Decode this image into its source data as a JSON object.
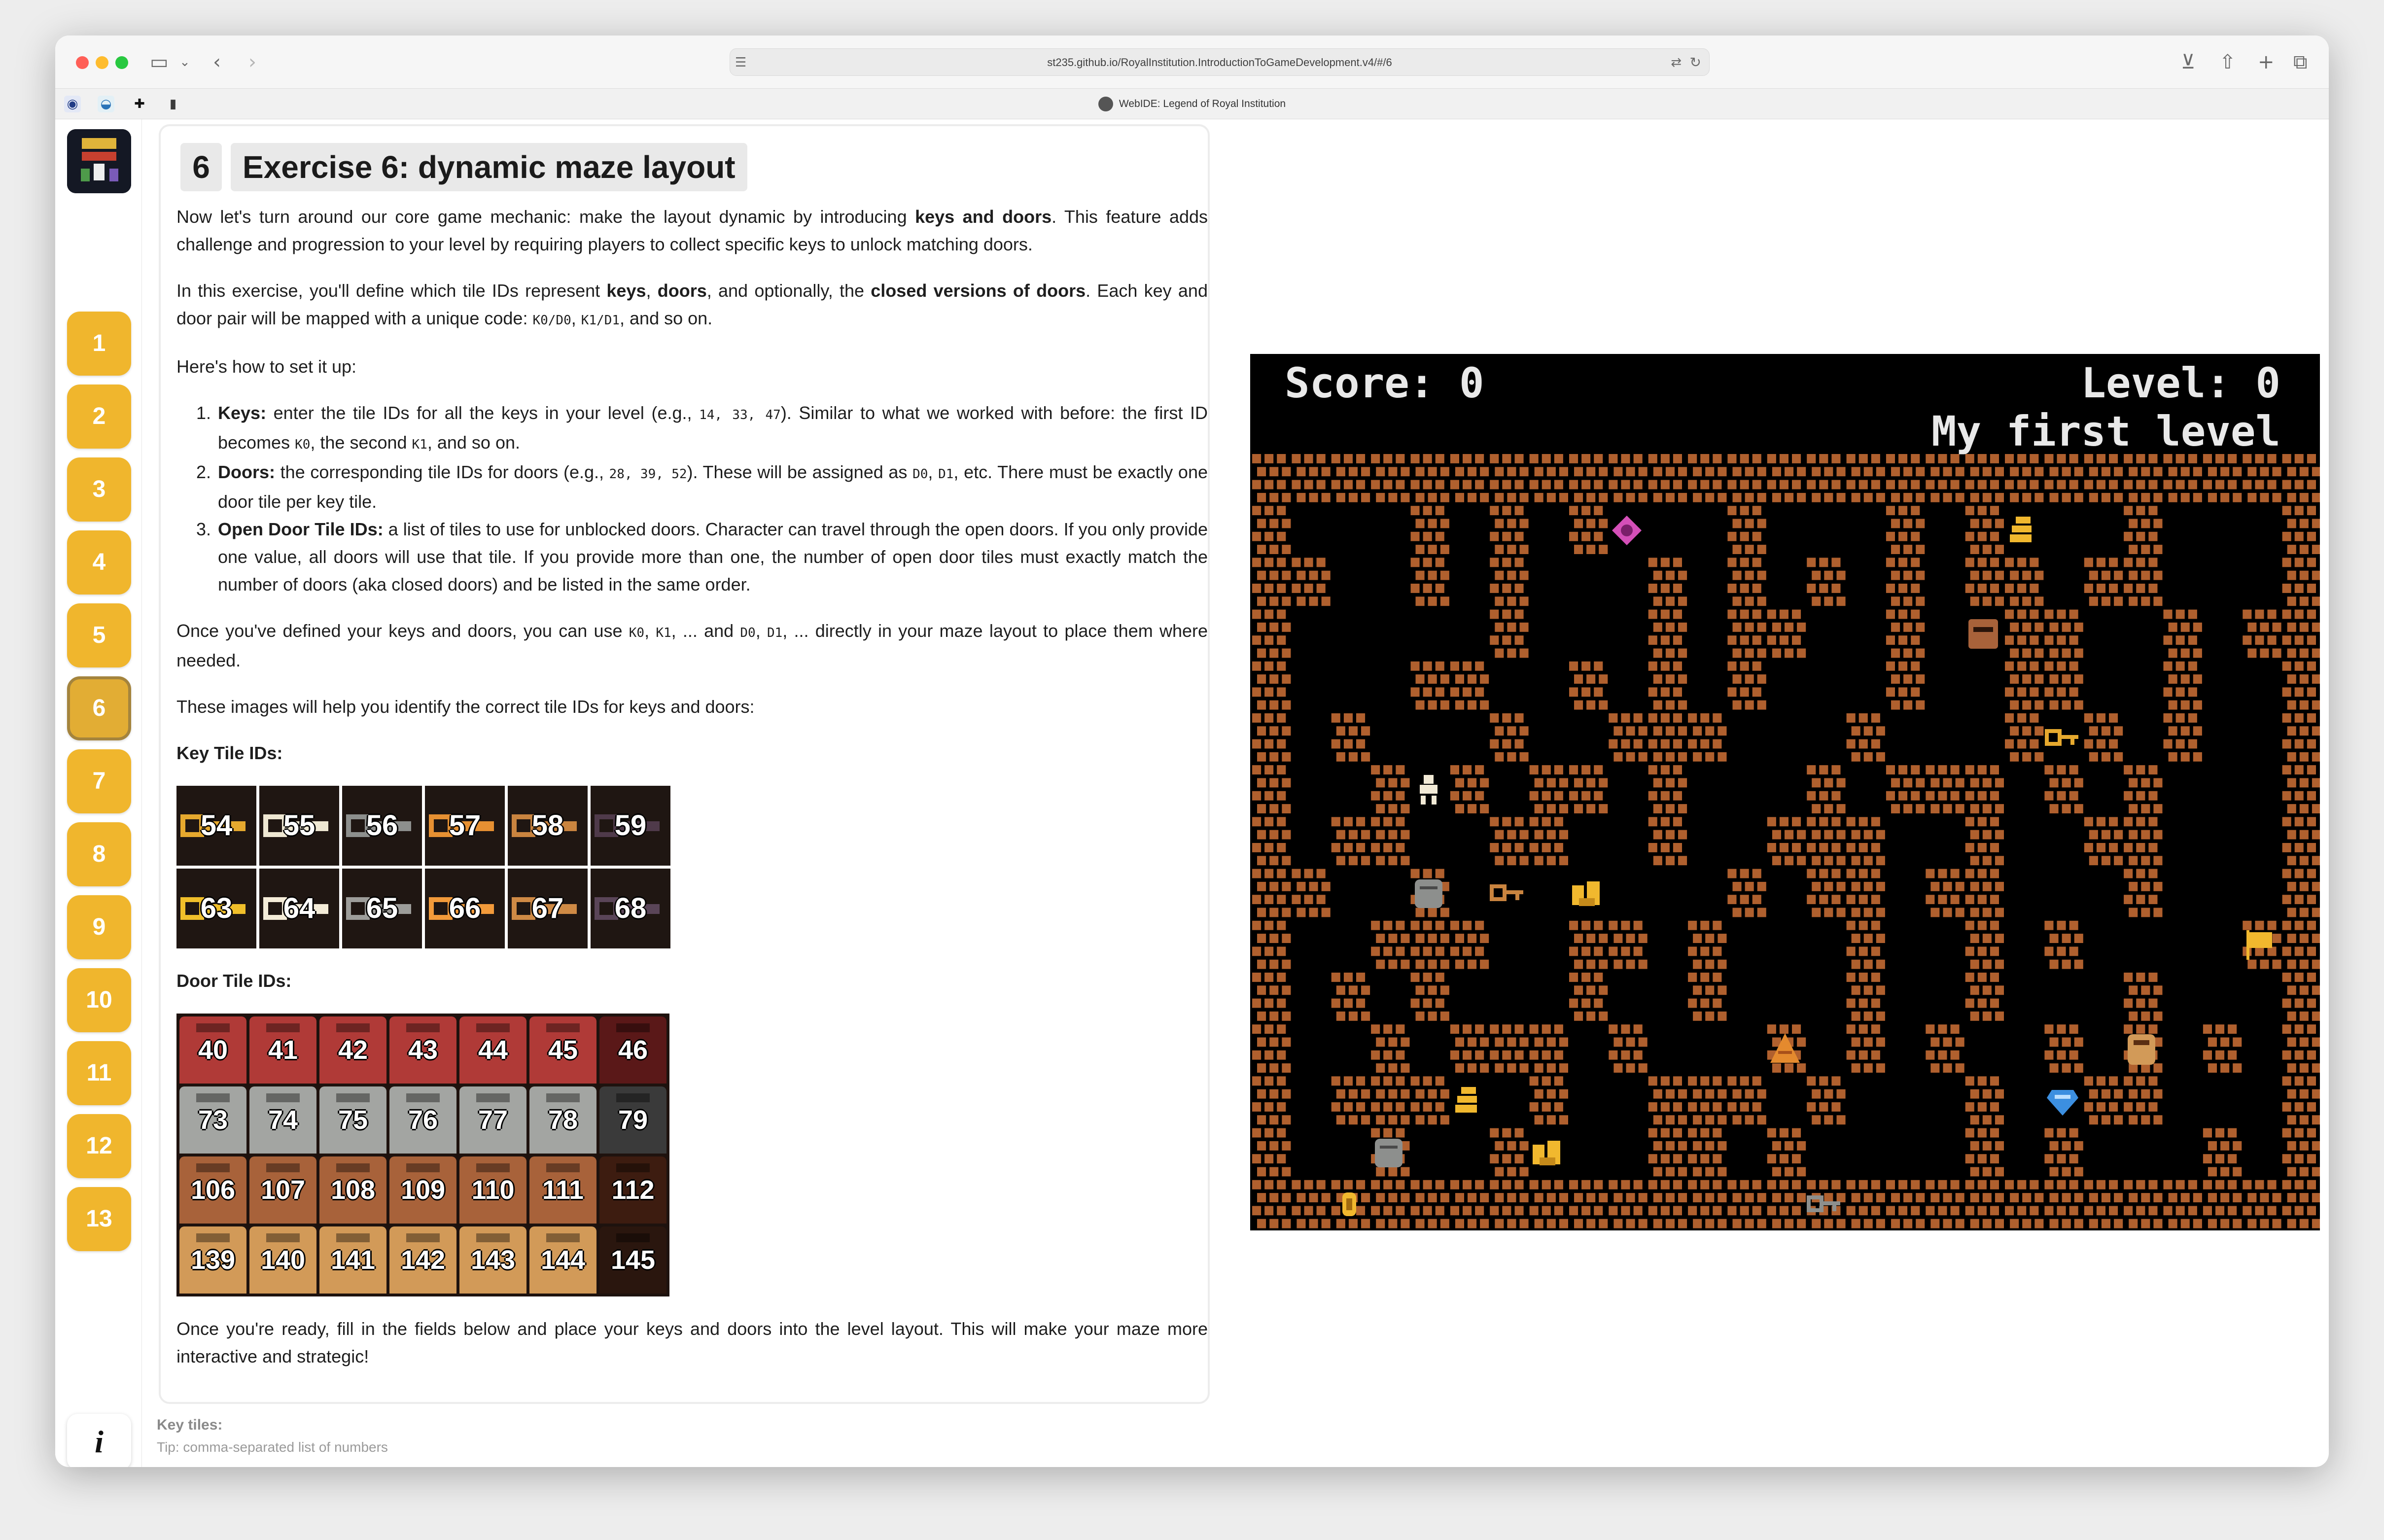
{
  "browser": {
    "url": "st235.github.io/RoyalInstitution.IntroductionToGameDevelopment.v4/#/6",
    "tab_title": "WebIDE: Legend of Royal Institution"
  },
  "sidebar": {
    "steps": [
      "1",
      "2",
      "3",
      "4",
      "5",
      "6",
      "7",
      "8",
      "9",
      "10",
      "11",
      "12",
      "13"
    ],
    "active_step": "6",
    "info_label": "i"
  },
  "exercise": {
    "number": "6",
    "title": "Exercise 6: dynamic maze layout",
    "p1": [
      {
        "t": "Now let's turn around our core game mechanic: make the layout dynamic by introducing "
      },
      {
        "t": "keys and doors",
        "b": true
      },
      {
        "t": ". This feature adds challenge and progression to your level by requiring players to collect specific keys to unlock matching doors."
      }
    ],
    "p2": [
      {
        "t": "In this exercise, you'll define which tile IDs represent "
      },
      {
        "t": "keys",
        "b": true
      },
      {
        "t": ", "
      },
      {
        "t": "doors",
        "b": true
      },
      {
        "t": ", and optionally, the "
      },
      {
        "t": "closed versions of doors",
        "b": true
      },
      {
        "t": ". Each key and door pair will be mapped with a unique code: "
      },
      {
        "t": "K0/D0",
        "c": true
      },
      {
        "t": ", "
      },
      {
        "t": "K1/D1",
        "c": true
      },
      {
        "t": ", and so on."
      }
    ],
    "p3": [
      {
        "t": "Here's how to set it up:"
      }
    ],
    "steps_list": [
      [
        {
          "t": "Keys:",
          "b": true
        },
        {
          "t": " enter the tile IDs for all the keys in your level (e.g., "
        },
        {
          "t": "14, 33, 47",
          "c": true
        },
        {
          "t": "). Similar to what we worked with before: the first ID becomes "
        },
        {
          "t": "K0",
          "c": true
        },
        {
          "t": ", the second "
        },
        {
          "t": "K1",
          "c": true
        },
        {
          "t": ", and so on."
        }
      ],
      [
        {
          "t": "Doors:",
          "b": true
        },
        {
          "t": " the corresponding tile IDs for doors (e.g., "
        },
        {
          "t": "28, 39, 52",
          "c": true
        },
        {
          "t": "). These will be assigned as "
        },
        {
          "t": "D0",
          "c": true
        },
        {
          "t": ", "
        },
        {
          "t": "D1",
          "c": true
        },
        {
          "t": ", etc. There must be exactly one door tile per key tile."
        }
      ],
      [
        {
          "t": "Open Door Tile IDs:",
          "b": true
        },
        {
          "t": " a list of tiles to use for unblocked doors. Character can travel through the open doors. If you only provide one value, all doors will use that tile. If you provide more than one, the number of open door tiles must exactly match the number of doors (aka closed doors) and be listed in the same order."
        }
      ]
    ],
    "p4": [
      {
        "t": "Once you've defined your keys and doors, you can use "
      },
      {
        "t": "K0",
        "c": true
      },
      {
        "t": ", "
      },
      {
        "t": "K1",
        "c": true
      },
      {
        "t": ", ... and "
      },
      {
        "t": "D0",
        "c": true
      },
      {
        "t": ", "
      },
      {
        "t": "D1",
        "c": true
      },
      {
        "t": ", ... directly in your maze layout to place them where needed."
      }
    ],
    "p5": [
      {
        "t": "These images will help you identify the correct tile IDs for keys and doors:"
      }
    ],
    "key_heading": "Key Tile IDs:",
    "key_tiles": [
      {
        "id": "54",
        "color": "#e6a92e"
      },
      {
        "id": "55",
        "color": "#eee7d2"
      },
      {
        "id": "56",
        "color": "#8d8f8d"
      },
      {
        "id": "57",
        "color": "#e69032"
      },
      {
        "id": "58",
        "color": "#c9843f"
      },
      {
        "id": "59",
        "color": "#4f3a4a"
      },
      {
        "id": "63",
        "color": "#f0bf2a"
      },
      {
        "id": "64",
        "color": "#f4ecd8"
      },
      {
        "id": "65",
        "color": "#9d9d9a"
      },
      {
        "id": "66",
        "color": "#f29a3a"
      },
      {
        "id": "67",
        "color": "#cf8a45"
      },
      {
        "id": "68",
        "color": "#5a4558"
      }
    ],
    "door_heading": "Door Tile IDs:",
    "door_tiles": [
      {
        "id": "40",
        "color": "#b03a37"
      },
      {
        "id": "41",
        "color": "#b03a37"
      },
      {
        "id": "42",
        "color": "#b03a37"
      },
      {
        "id": "43",
        "color": "#b03a37"
      },
      {
        "id": "44",
        "color": "#b03a37"
      },
      {
        "id": "45",
        "color": "#b03a37"
      },
      {
        "id": "46",
        "color": "#5a1818"
      },
      {
        "id": "73",
        "color": "#a3a5a2"
      },
      {
        "id": "74",
        "color": "#a3a5a2"
      },
      {
        "id": "75",
        "color": "#a3a5a2"
      },
      {
        "id": "76",
        "color": "#a3a5a2"
      },
      {
        "id": "77",
        "color": "#a3a5a2"
      },
      {
        "id": "78",
        "color": "#a3a5a2"
      },
      {
        "id": "79",
        "color": "#3a3a3a"
      },
      {
        "id": "106",
        "color": "#a8623a"
      },
      {
        "id": "107",
        "color": "#a8623a"
      },
      {
        "id": "108",
        "color": "#a8623a"
      },
      {
        "id": "109",
        "color": "#a8623a"
      },
      {
        "id": "110",
        "color": "#a8623a"
      },
      {
        "id": "111",
        "color": "#a8623a"
      },
      {
        "id": "112",
        "color": "#3d1c10"
      },
      {
        "id": "139",
        "color": "#d29a58"
      },
      {
        "id": "140",
        "color": "#d29a58"
      },
      {
        "id": "141",
        "color": "#d29a58"
      },
      {
        "id": "142",
        "color": "#d29a58"
      },
      {
        "id": "143",
        "color": "#d29a58"
      },
      {
        "id": "144",
        "color": "#d29a58"
      },
      {
        "id": "145",
        "color": "#2a160e"
      }
    ],
    "p6": [
      {
        "t": "Once you're ready, fill in the fields below and place your keys and doors into the level layout. This will make your maze more interactive and strategic!"
      }
    ]
  },
  "form": {
    "key_label": "Key tiles:",
    "key_tip": "Tip: comma-separated list of numbers"
  },
  "game": {
    "score": "Score: 0",
    "level": "Level: 0",
    "level_name": "My first level",
    "brick_color": "#b0602e",
    "maze": [
      "###########################",
      "#   # # #   #   # #   #   #",
      "##  # #   # # # # ## ##   #",
      "#     #   # ##  #  ##  # ##",
      "#   ##  # # #   #  ##  #  #",
      "# #   #  ###   #   # # #  #",
      "#  # # ## #   # ### # #   #",
      "# ##  ##  #  ###  #  ##   #",
      "##  #       # ## ##   #   #",
      "#  ###  ## #   #  # #    ##",
      "# # #   #  #   #  #   #   #",
      "#  # ### #   # # #  # # # #",
      "# ###  #  ### #   #  ##   #",
      "#  #  #   ## #    # #   # #",
      "###########################"
    ],
    "sprites": [
      {
        "kind": "gem-pink",
        "col": 9,
        "row": 1,
        "color": "#d44fb8"
      },
      {
        "kind": "coin-stack",
        "col": 19,
        "row": 1,
        "color": "#f1b82e"
      },
      {
        "kind": "chest",
        "col": 18,
        "row": 3,
        "color": "#a8623a"
      },
      {
        "kind": "key",
        "col": 20,
        "row": 5,
        "color": "#e6a92e"
      },
      {
        "kind": "hero",
        "col": 4,
        "row": 6,
        "color": "#f2ead6"
      },
      {
        "kind": "tombstone",
        "col": 4,
        "row": 8,
        "color": "#8d8f8d"
      },
      {
        "kind": "key",
        "col": 6,
        "row": 8,
        "color": "#c9843f"
      },
      {
        "kind": "coin-pile",
        "col": 8,
        "row": 8,
        "color": "#f1b82e"
      },
      {
        "kind": "flag",
        "col": 25,
        "row": 9,
        "color": "#f1b82e"
      },
      {
        "kind": "cone",
        "col": 13,
        "row": 11,
        "color": "#e48a2e"
      },
      {
        "kind": "door",
        "col": 22,
        "row": 11,
        "color": "#d29a58"
      },
      {
        "kind": "coin-stack",
        "col": 5,
        "row": 12,
        "color": "#f1b82e"
      },
      {
        "kind": "gem-blue",
        "col": 20,
        "row": 12,
        "color": "#3c8fe0"
      },
      {
        "kind": "tombstone",
        "col": 3,
        "row": 13,
        "color": "#8d8f8d"
      },
      {
        "kind": "coin-pile",
        "col": 7,
        "row": 13,
        "color": "#f1b82e"
      },
      {
        "kind": "key",
        "col": 14,
        "row": 14,
        "color": "#8d8f8d"
      },
      {
        "kind": "coin",
        "col": 2,
        "row": 14,
        "color": "#f1b82e"
      }
    ]
  }
}
